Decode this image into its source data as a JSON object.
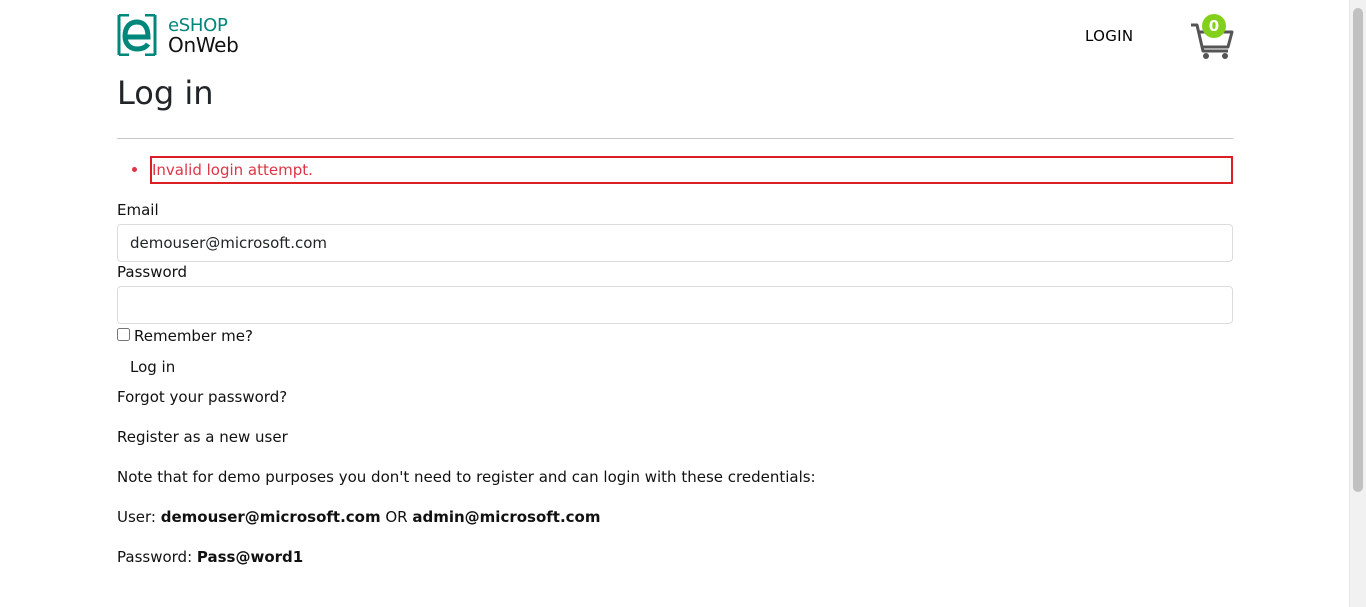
{
  "header": {
    "brand_line1": "eSHOP",
    "brand_line2": "OnWeb",
    "login_label": "LOGIN",
    "cart_count": "0"
  },
  "page": {
    "title": "Log in",
    "error": "Invalid login attempt."
  },
  "form": {
    "email_label": "Email",
    "email_value": "demouser@microsoft.com",
    "password_label": "Password",
    "password_value": "",
    "remember_label": "Remember me?",
    "submit_label": "Log in"
  },
  "links": {
    "forgot": "Forgot your password?",
    "register": "Register as a new user"
  },
  "note": {
    "text": "Note that for demo purposes you don't need to register and can login with these credentials:",
    "user_prefix": "User: ",
    "user1": "demouser@microsoft.com",
    "or": " OR ",
    "user2": "admin@microsoft.com",
    "password_prefix": "Password: ",
    "password": "Pass@word1"
  },
  "colors": {
    "brand": "#00877c",
    "badge": "#83d01b",
    "error": "#dc3545"
  },
  "icons": [
    "logo-e-icon",
    "cart-icon"
  ]
}
